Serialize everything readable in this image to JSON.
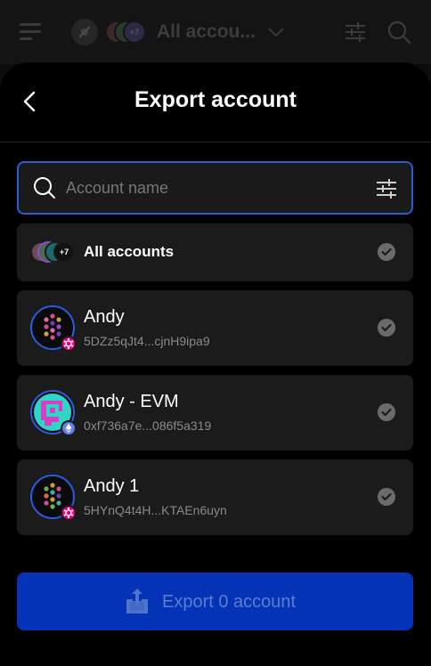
{
  "topbar": {
    "title": "All accou...",
    "avatar_overflow": "+7"
  },
  "header": {
    "title": "Export account"
  },
  "search": {
    "placeholder": "Account name"
  },
  "list": {
    "all_accounts_label": "All accounts",
    "all_accounts_overflow": "+7",
    "accounts": [
      {
        "name": "Andy",
        "address": "5DZz5qJt4...cjnH9ipa9",
        "network": "polkadot"
      },
      {
        "name": "Andy - EVM",
        "address": "0xf736a7e...086f5a319",
        "network": "ethereum"
      },
      {
        "name": "Andy 1",
        "address": "5HYnQ4t4H...KTAEn6uyn",
        "network": "polkadot"
      }
    ]
  },
  "footer": {
    "export_label": "Export 0 account"
  },
  "colors": {
    "accent": "#2a5bd0",
    "button": "#0433b8",
    "polkadot": "#e6007a",
    "ethereum": "#627eea"
  }
}
